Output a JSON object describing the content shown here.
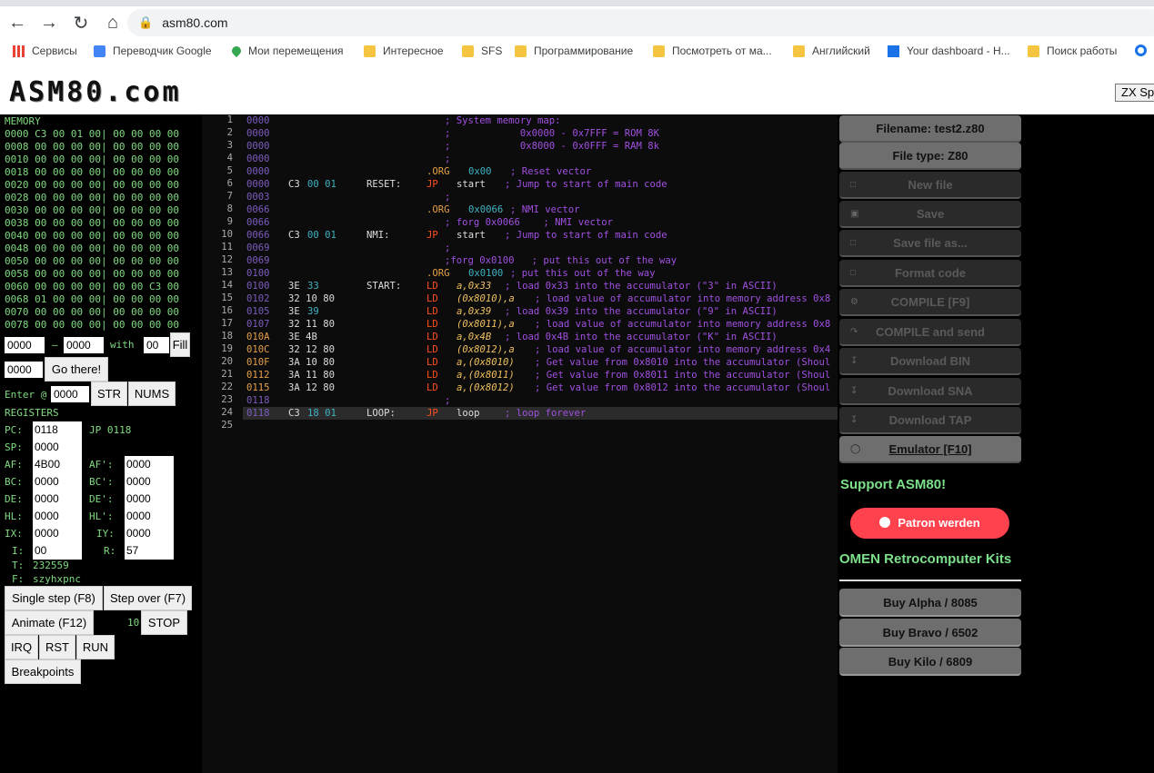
{
  "browser": {
    "url": "asm80.com",
    "bookmarks": [
      "Сервисы",
      "Переводчик Google",
      "Мои перемещения",
      "Интересное",
      "SFS",
      "Программирование",
      "Посмотреть от ма...",
      "Английский",
      "Your dashboard - H...",
      "Поиск работы"
    ]
  },
  "header": {
    "logo": "ASM80.com",
    "zx_button": "ZX Sp"
  },
  "memory": {
    "title": "MEMORY",
    "rows": [
      "0000 C3 00 01 00| 00 00 00 00",
      "0008 00 00 00 00| 00 00 00 00",
      "0010 00 00 00 00| 00 00 00 00",
      "0018 00 00 00 00| 00 00 00 00",
      "0020 00 00 00 00| 00 00 00 00",
      "0028 00 00 00 00| 00 00 00 00",
      "0030 00 00 00 00| 00 00 00 00",
      "0038 00 00 00 00| 00 00 00 00",
      "0040 00 00 00 00| 00 00 00 00",
      "0048 00 00 00 00| 00 00 00 00",
      "0050 00 00 00 00| 00 00 00 00",
      "0058 00 00 00 00| 00 00 00 00",
      "0060 00 00 00 00| 00 00 C3 00",
      "0068 01 00 00 00| 00 00 00 00",
      "0070 00 00 00 00| 00 00 00 00",
      "0078 00 00 00 00| 00 00 00 00"
    ],
    "fill_from": "0000",
    "dash": "–",
    "fill_to": "0000",
    "with_label": "with",
    "fill_value": "00",
    "fill_button": "Fill",
    "goto_value": "0000",
    "goto_button": "Go there!",
    "enter_label": "Enter @",
    "enter_value": "0000",
    "str_button": "STR",
    "nums_button": "NUMS"
  },
  "registers": {
    "title": "REGISTERS",
    "pc_label": "PC:",
    "pc": "0118",
    "pc_instr": "JP 0118",
    "sp_label": "SP:",
    "sp": "0000",
    "af_label": "AF:",
    "af": "4B00",
    "af2_label": "AF':",
    "af2": "0000",
    "bc_label": "BC:",
    "bc": "0000",
    "bc2_label": "BC':",
    "bc2": "0000",
    "de_label": "DE:",
    "de": "0000",
    "de2_label": "DE':",
    "de2": "0000",
    "hl_label": "HL:",
    "hl": "0000",
    "hl2_label": "HL':",
    "hl2": "0000",
    "ix_label": "IX:",
    "ix": "0000",
    "iy_label": "IY:",
    "iy": "0000",
    "i_label": "I:",
    "i": "00",
    "r_label": "R:",
    "r": "57",
    "t_label": "T:",
    "t": "232559",
    "f_label": "F:",
    "f": "szyhxpnc"
  },
  "controls": {
    "single_step": "Single step (F8)",
    "step_over": "Step over (F7)",
    "animate": "Animate (F12)",
    "speed": "10",
    "stop": "STOP",
    "irq": "IRQ",
    "rst": "RST",
    "run": "RUN",
    "breakpoints": "Breakpoints"
  },
  "editor": {
    "current_line": 24,
    "lines": [
      {
        "n": "1",
        "addr": "0000",
        "bytes": "",
        "bytes2": "",
        "label": "",
        "op": "",
        "arg": "",
        "cmt": "; System memory map:",
        "type": "c"
      },
      {
        "n": "2",
        "addr": "0000",
        "bytes": "",
        "bytes2": "",
        "label": "",
        "op": "",
        "arg": "",
        "cmt": ";            0x0000 - 0x7FFF = ROM 8K",
        "type": "c"
      },
      {
        "n": "3",
        "addr": "0000",
        "bytes": "",
        "bytes2": "",
        "label": "",
        "op": "",
        "arg": "",
        "cmt": ";            0x8000 - 0x0FFF = RAM 8k",
        "type": "c"
      },
      {
        "n": "4",
        "addr": "0000",
        "bytes": "",
        "bytes2": "",
        "label": "",
        "op": "",
        "arg": "",
        "cmt": ";",
        "type": "c"
      },
      {
        "n": "5",
        "addr": "0000",
        "bytes": "",
        "bytes2": "",
        "label": "",
        "op": ".ORG",
        "arg": "0x00",
        "cmt": "; Reset vector",
        "type": "d"
      },
      {
        "n": "6",
        "addr": "0000",
        "bytes": "C3",
        "bytes2": "00 01",
        "label": "RESET:",
        "op": "JP",
        "arg": "start",
        "cmt": "; Jump to start of main code",
        "type": "i"
      },
      {
        "n": "7",
        "addr": "0003",
        "bytes": "",
        "bytes2": "",
        "label": "",
        "op": "",
        "arg": "",
        "cmt": ";",
        "type": "c"
      },
      {
        "n": "8",
        "addr": "0066",
        "bytes": "",
        "bytes2": "",
        "label": "",
        "op": ".ORG",
        "arg": "0x0066",
        "cmt": "; NMI vector",
        "type": "d"
      },
      {
        "n": "9",
        "addr": "0066",
        "bytes": "",
        "bytes2": "",
        "label": "",
        "op": "",
        "arg": "",
        "cmt": "; forg 0x0066    ; NMI vector",
        "type": "c"
      },
      {
        "n": "10",
        "addr": "0066",
        "bytes": "C3",
        "bytes2": "00 01",
        "label": "NMI:",
        "op": "JP",
        "arg": "start",
        "cmt": "; Jump to start of main code",
        "type": "i"
      },
      {
        "n": "11",
        "addr": "0069",
        "bytes": "",
        "bytes2": "",
        "label": "",
        "op": "",
        "arg": "",
        "cmt": ";",
        "type": "c"
      },
      {
        "n": "12",
        "addr": "0069",
        "bytes": "",
        "bytes2": "",
        "label": "",
        "op": "",
        "arg": "",
        "cmt": ";forg 0x0100   ; put this out of the way",
        "type": "c"
      },
      {
        "n": "13",
        "addr": "0100",
        "bytes": "",
        "bytes2": "",
        "label": "",
        "op": ".ORG",
        "arg": "0x0100",
        "cmt": "; put this out of the way",
        "type": "d"
      },
      {
        "n": "14",
        "addr": "0100",
        "bytes": "3E",
        "bytes2": "33",
        "label": "START:",
        "op": "LD",
        "arg": "a,0x33",
        "cmt": "; load 0x33 into the accumulator (\"3\" in ASCII)",
        "type": "i"
      },
      {
        "n": "15",
        "addr": "0102",
        "bytes": "32 10 80",
        "bytes2": "",
        "label": "",
        "op": "LD",
        "arg": "(0x8010),a",
        "cmt": "; load value of accumulator into memory address 0x8",
        "type": "i"
      },
      {
        "n": "16",
        "addr": "0105",
        "bytes": "3E",
        "bytes2": "39",
        "label": "",
        "op": "LD",
        "arg": "a,0x39",
        "cmt": "; load 0x39 into the accumulator (\"9\" in ASCII)",
        "type": "i"
      },
      {
        "n": "17",
        "addr": "0107",
        "bytes": "32 11 80",
        "bytes2": "",
        "label": "",
        "op": "LD",
        "arg": "(0x8011),a",
        "cmt": "; load value of accumulator into memory address 0x8",
        "type": "i"
      },
      {
        "n": "18",
        "addr": "010A",
        "bytes": "3E 4B",
        "bytes2": "",
        "label": "",
        "op": "LD",
        "arg": "a,0x4B",
        "cmt": "; load 0x4B into the accumulator (\"K\" in ASCII)",
        "type": "i"
      },
      {
        "n": "19",
        "addr": "010C",
        "bytes": "32 12 80",
        "bytes2": "",
        "label": "",
        "op": "LD",
        "arg": "(0x8012),a",
        "cmt": "; load value of accumulator into memory address 0x4",
        "type": "i"
      },
      {
        "n": "20",
        "addr": "010F",
        "bytes": "3A 10 80",
        "bytes2": "",
        "label": "",
        "op": "LD",
        "arg": "a,(0x8010)",
        "cmt": "; Get value from 0x8010 into the accumulator (Shoul",
        "type": "i"
      },
      {
        "n": "21",
        "addr": "0112",
        "bytes": "3A 11 80",
        "bytes2": "",
        "label": "",
        "op": "LD",
        "arg": "a,(0x8011)",
        "cmt": "; Get value from 0x8011 into the accumulator (Shoul",
        "type": "i"
      },
      {
        "n": "22",
        "addr": "0115",
        "bytes": "3A 12 80",
        "bytes2": "",
        "label": "",
        "op": "LD",
        "arg": "a,(0x8012)",
        "cmt": "; Get value from 0x8012 into the accumulator (Shoul",
        "type": "i"
      },
      {
        "n": "23",
        "addr": "0118",
        "bytes": "",
        "bytes2": "",
        "label": "",
        "op": "",
        "arg": "",
        "cmt": ";",
        "type": "c"
      },
      {
        "n": "24",
        "addr": "0118",
        "bytes": "C3",
        "bytes2": "18 01",
        "label": "LOOP:",
        "op": "JP",
        "arg": "loop",
        "cmt": "; loop forever",
        "type": "i"
      },
      {
        "n": "25",
        "addr": "",
        "bytes": "",
        "bytes2": "",
        "label": "",
        "op": "",
        "arg": "",
        "cmt": "",
        "type": "c"
      }
    ]
  },
  "right": {
    "filename": "Filename: test2.z80",
    "filetype": "File type: Z80",
    "new_file": "New file",
    "save": "Save",
    "save_as": "Save file as...",
    "format": "Format code",
    "compile": "COMPILE [F9]",
    "compile_send": "COMPILE and send",
    "download_bin": "Download BIN",
    "download_sna": "Download SNA",
    "download_tap": "Download TAP",
    "emulator": "Emulator [F10]",
    "support": "Support ASM80!",
    "patron": "Patron werden",
    "omen": "OMEN Retrocomputer Kits",
    "buy_alpha": "Buy Alpha / 8085",
    "buy_bravo": "Buy Bravo / 6502",
    "buy_kilo": "Buy Kilo / 6809"
  },
  "colors": {
    "accent_green": "#7ce08a",
    "patreon": "#ff424d",
    "mnemonic": "#ff4f1f",
    "comment": "#a050e0"
  }
}
